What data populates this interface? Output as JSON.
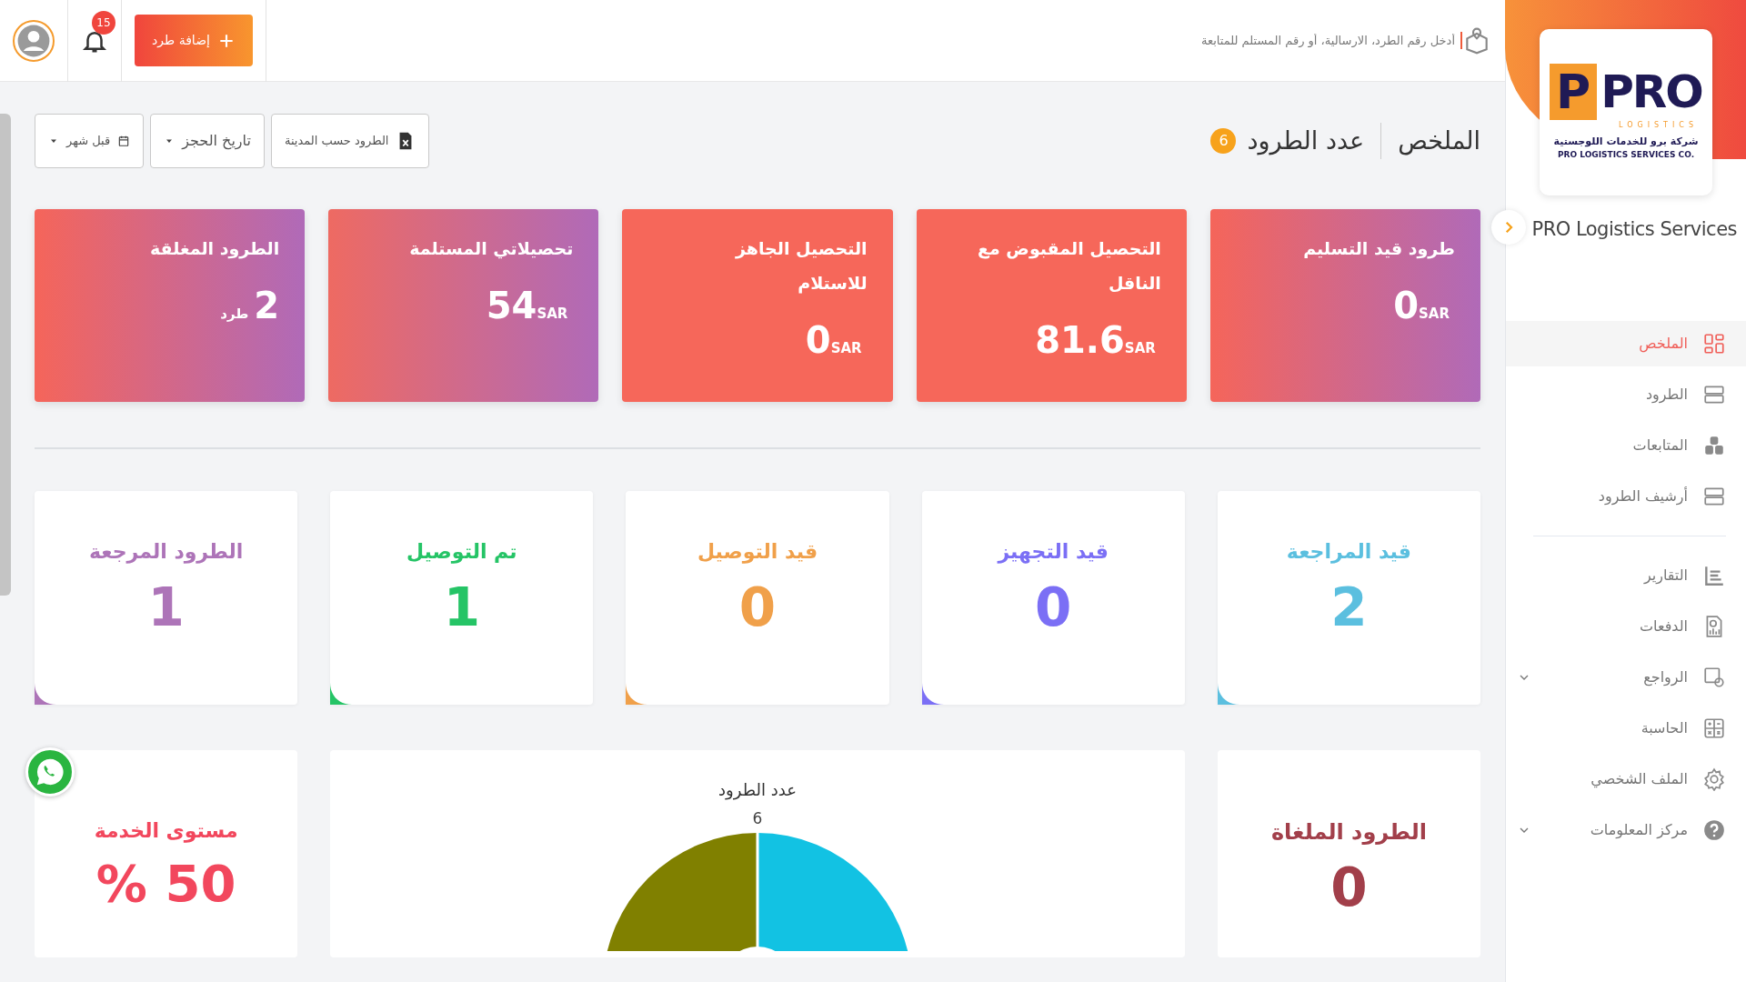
{
  "sidebar": {
    "logo": {
      "mark": "P",
      "wordmark": "PRO",
      "tagline": "LOGISTICS",
      "arabic_name": "شركة برو للخدمات اللوجستية",
      "english_name": "PRO LOGISTICS SERVICES CO."
    },
    "company": "PRO Logistics Services",
    "groups": [
      [
        {
          "label": "الملخص",
          "selected": true,
          "expandable": false
        },
        {
          "label": "الطرود",
          "selected": false,
          "expandable": false
        },
        {
          "label": "المتابعات",
          "selected": false,
          "expandable": false
        },
        {
          "label": "أرشيف الطرود",
          "selected": false,
          "expandable": false
        }
      ],
      [
        {
          "label": "التقارير",
          "selected": false,
          "expandable": false
        },
        {
          "label": "الدفعات",
          "selected": false,
          "expandable": false
        },
        {
          "label": "الرواجع",
          "selected": false,
          "expandable": true
        },
        {
          "label": "الحاسبة",
          "selected": false,
          "expandable": false
        },
        {
          "label": "الملف الشخصي",
          "selected": false,
          "expandable": false
        },
        {
          "label": "مركز المعلومات",
          "selected": false,
          "expandable": true
        }
      ]
    ]
  },
  "topbar": {
    "search": {
      "placeholder": "أدخل رقم الطرد، الارسالية، أو رقم المستلم للمتابعة"
    },
    "add_button": "إضافة طرد",
    "notifications": "15"
  },
  "header": {
    "title": "الملخص",
    "count_label": "عدد الطرود",
    "count": "6",
    "filters": [
      {
        "kind": "export",
        "label": "الطرود حسب المدينة"
      },
      {
        "kind": "select",
        "label": "تاريخ الحجز"
      },
      {
        "kind": "date",
        "label": "قبل شهر"
      }
    ]
  },
  "summary_cards": [
    {
      "title": "طرود قيد التسليم",
      "amount": "0",
      "unit": "SAR"
    },
    {
      "title": "التحصيل المقبوض مع الناقل",
      "amount": "81.6",
      "unit": "SAR"
    },
    {
      "title": "التحصيل الجاهز للاستلام",
      "amount": "0",
      "unit": "SAR"
    },
    {
      "title": "تحصيلاتي المستلمة",
      "amount": "54",
      "unit": "SAR"
    },
    {
      "title": "الطرود المغلقة",
      "amount": "2",
      "unit": "طرد"
    }
  ],
  "status_cards": [
    {
      "title": "قيد المراجعة",
      "value": "2",
      "color": "#5bbfdf"
    },
    {
      "title": "قيد التجهيز",
      "value": "0",
      "color": "#7b6ff5"
    },
    {
      "title": "قيد التوصيل",
      "value": "0",
      "color": "#f0a04a"
    },
    {
      "title": "تم التوصيل",
      "value": "1",
      "color": "#25c466"
    },
    {
      "title": "الطرود المرجعة",
      "value": "1",
      "color": "#ad74b8"
    }
  ],
  "bottom": {
    "cancelled": {
      "title": "الطرود الملغاة",
      "value": "0"
    },
    "chart": {
      "title": "عدد الطرود",
      "total": "6"
    },
    "service_level": {
      "title": "مستوى الخدمة",
      "value": "50 %"
    }
  }
}
